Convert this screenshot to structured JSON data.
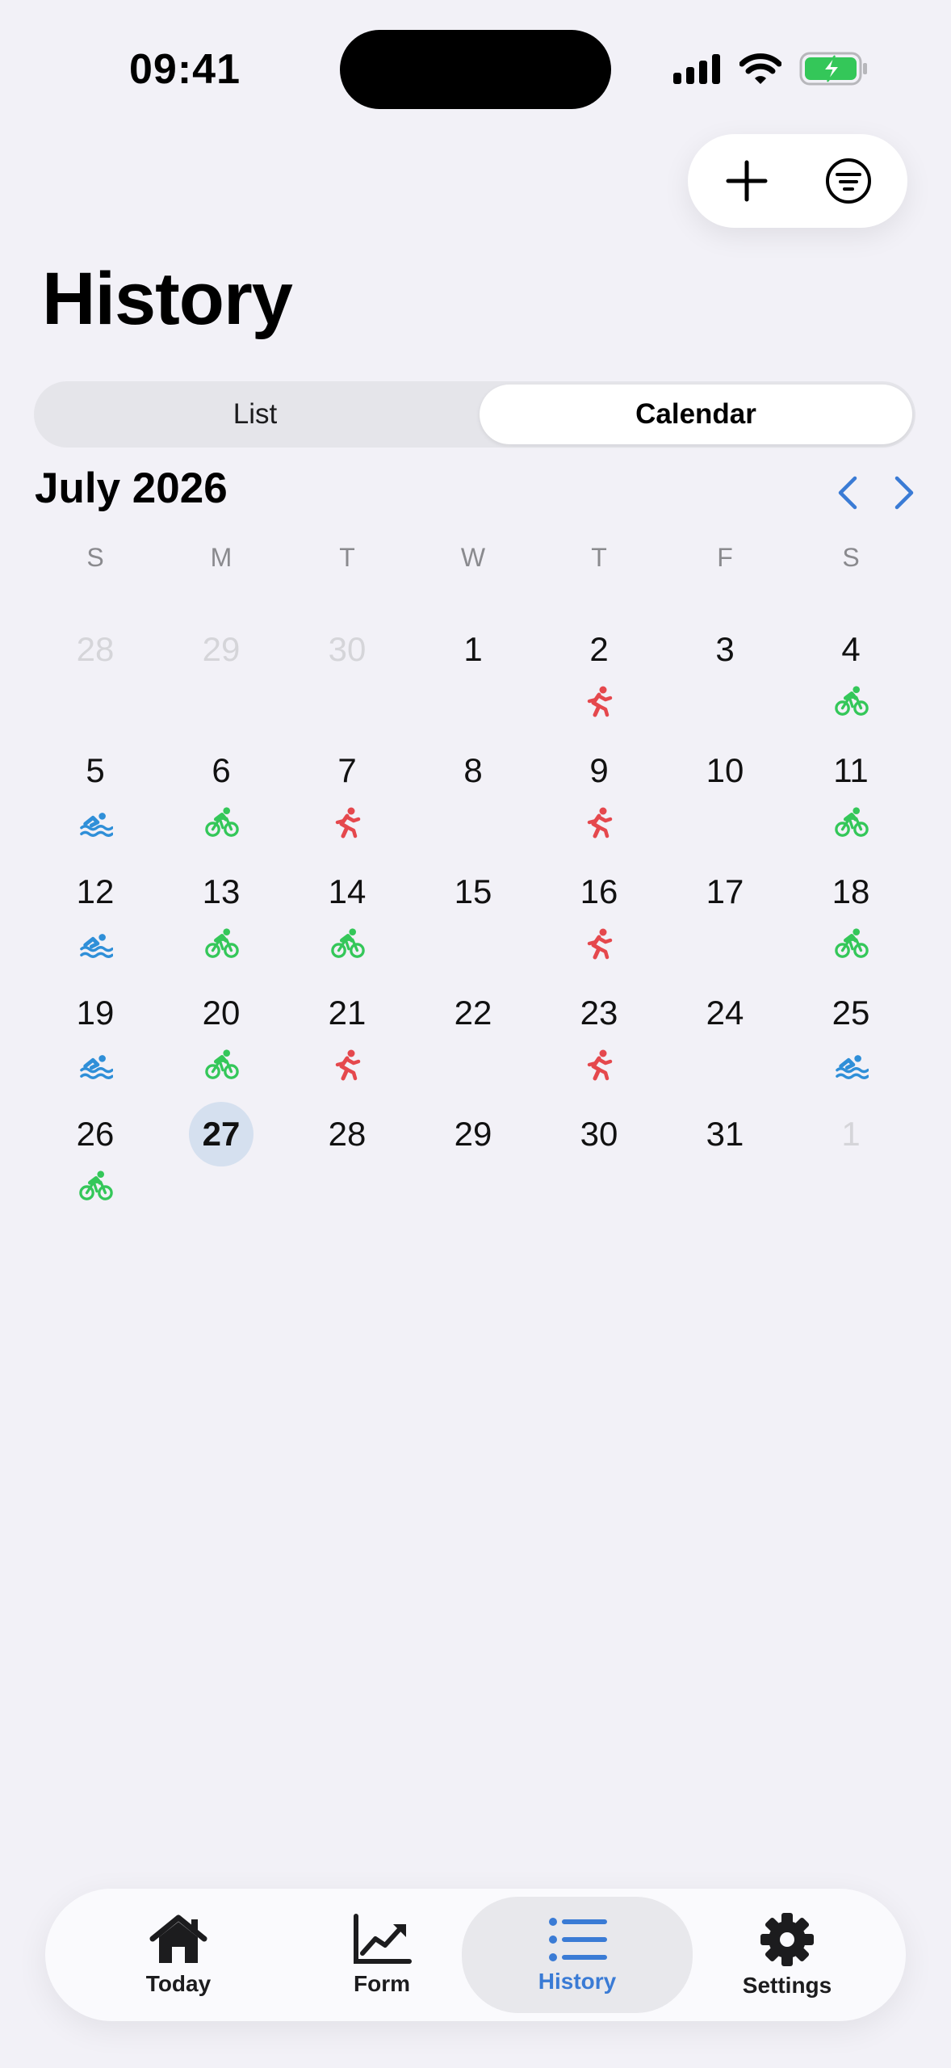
{
  "status_bar": {
    "time": "09:41"
  },
  "page_title": "History",
  "segmented": {
    "list_label": "List",
    "calendar_label": "Calendar",
    "selected": "Calendar"
  },
  "calendar": {
    "month_label": "July 2026",
    "weekdays": [
      "S",
      "M",
      "T",
      "W",
      "T",
      "F",
      "S"
    ],
    "weeks": [
      [
        {
          "day": "28",
          "muted": true,
          "activity": null
        },
        {
          "day": "29",
          "muted": true,
          "activity": null
        },
        {
          "day": "30",
          "muted": true,
          "activity": null
        },
        {
          "day": "1",
          "activity": null
        },
        {
          "day": "2",
          "activity": "run"
        },
        {
          "day": "3",
          "activity": null
        },
        {
          "day": "4",
          "activity": "bike"
        }
      ],
      [
        {
          "day": "5",
          "activity": "swim"
        },
        {
          "day": "6",
          "activity": "bike"
        },
        {
          "day": "7",
          "activity": "run"
        },
        {
          "day": "8",
          "activity": null
        },
        {
          "day": "9",
          "activity": "run"
        },
        {
          "day": "10",
          "activity": null
        },
        {
          "day": "11",
          "activity": "bike"
        }
      ],
      [
        {
          "day": "12",
          "activity": "swim"
        },
        {
          "day": "13",
          "activity": "bike"
        },
        {
          "day": "14",
          "activity": "bike"
        },
        {
          "day": "15",
          "activity": null
        },
        {
          "day": "16",
          "activity": "run"
        },
        {
          "day": "17",
          "activity": null
        },
        {
          "day": "18",
          "activity": "bike"
        }
      ],
      [
        {
          "day": "19",
          "activity": "swim"
        },
        {
          "day": "20",
          "activity": "bike"
        },
        {
          "day": "21",
          "activity": "run"
        },
        {
          "day": "22",
          "activity": null
        },
        {
          "day": "23",
          "activity": "run"
        },
        {
          "day": "24",
          "activity": null
        },
        {
          "day": "25",
          "activity": "swim"
        }
      ],
      [
        {
          "day": "26",
          "activity": "bike"
        },
        {
          "day": "27",
          "today": true,
          "activity": null
        },
        {
          "day": "28",
          "activity": null
        },
        {
          "day": "29",
          "activity": null
        },
        {
          "day": "30",
          "activity": null
        },
        {
          "day": "31",
          "activity": null
        },
        {
          "day": "1",
          "muted": true,
          "activity": null
        }
      ]
    ]
  },
  "activity_colors": {
    "run": "#e5484d",
    "bike": "#34c759",
    "swim": "#2f8fd8"
  },
  "accent_color": "#3a7bd5",
  "tabs": [
    {
      "label": "Today",
      "icon": "house-icon"
    },
    {
      "label": "Form",
      "icon": "chart-line-icon"
    },
    {
      "label": "History",
      "icon": "list-icon",
      "active": true
    },
    {
      "label": "Settings",
      "icon": "gear-icon"
    }
  ]
}
